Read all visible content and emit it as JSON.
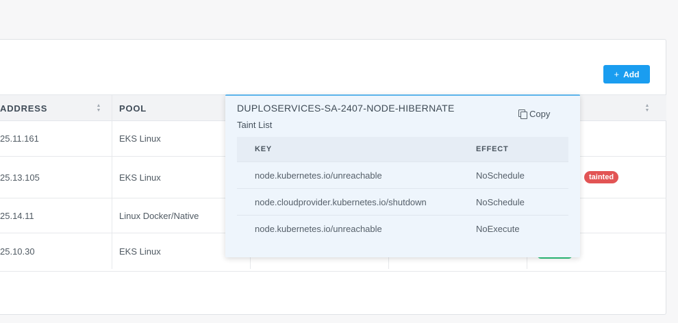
{
  "toolbar": {
    "add_label": "Add",
    "add_icon": "plus-icon"
  },
  "table": {
    "headers": {
      "address": "ADDRESS",
      "pool": "POOL"
    },
    "rows": [
      {
        "address": "25.11.161",
        "pool": "EKS Linux"
      },
      {
        "address": "25.13.105",
        "pool": "EKS Linux"
      },
      {
        "address": "25.14.11",
        "pool": "Linux Docker/Native"
      },
      {
        "address": "25.10.30",
        "pool": "EKS Linux"
      }
    ],
    "badge": "tainted",
    "colors": {
      "tainted": "#e25454",
      "ready": "#2bc27a",
      "accent": "#1a9df0"
    }
  },
  "popover": {
    "title": "DUPLOSERVICES-SA-2407-NODE-HIBERNATE",
    "subtitle": "Taint List",
    "copy_label": "Copy",
    "headers": {
      "key": "KEY",
      "effect": "EFFECT"
    },
    "taints": [
      {
        "key": "node.kubernetes.io/unreachable",
        "effect": "NoSchedule"
      },
      {
        "key": "node.cloudprovider.kubernetes.io/shutdown",
        "effect": "NoSchedule"
      },
      {
        "key": "node.kubernetes.io/unreachable",
        "effect": "NoExecute"
      }
    ]
  }
}
